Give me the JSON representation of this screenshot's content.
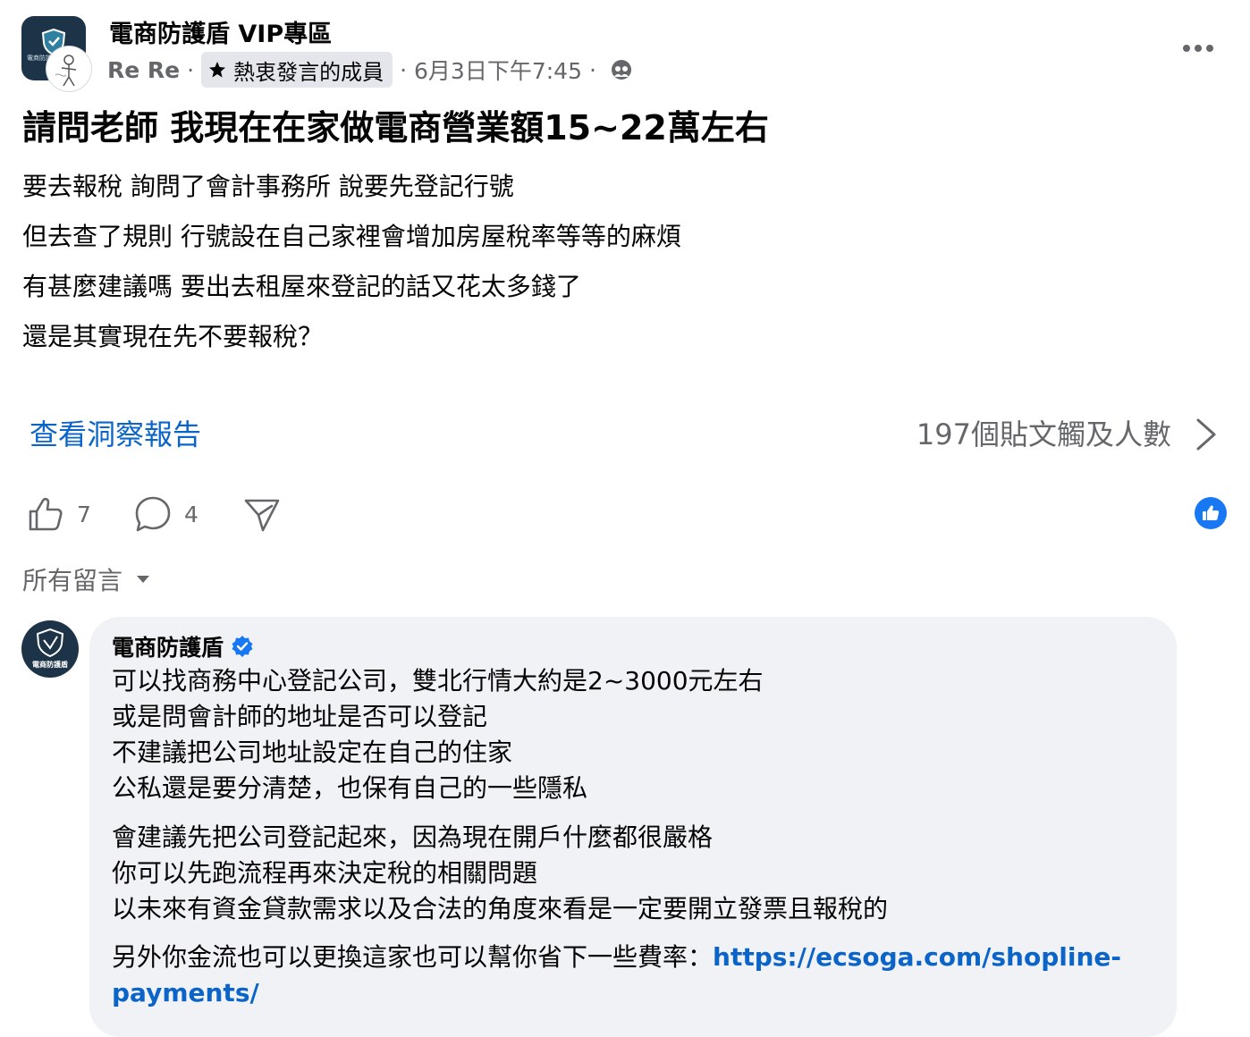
{
  "header": {
    "group_name": "電商防護盾 VIP專區",
    "group_avatar_text": "電商防護",
    "author": "Re Re",
    "badge_label": "熱衷發言的成員",
    "timestamp": "6月3日下午7:45",
    "separator": "·"
  },
  "post": {
    "title": "請問老師 我現在在家做電商營業額15~22萬左右",
    "lines": [
      "要去報稅 詢問了會計事務所 說要先登記行號",
      "但去查了規則 行號設在自己家裡會增加房屋稅率等等的麻煩",
      "有甚麼建議嗎 要出去租屋來登記的話又花太多錢了",
      "還是其實現在先不要報稅？"
    ]
  },
  "insights": {
    "link_label": "查看洞察報告",
    "reach_label": "197個貼文觸及人數"
  },
  "actions": {
    "like_count": "7",
    "comment_count": "4"
  },
  "comments": {
    "sort_label": "所有留言",
    "first": {
      "author": "電商防護盾",
      "avatar_text": "電商防護盾",
      "lines": [
        "可以找商務中心登記公司，雙北行情大約是2~3000元左右",
        "或是問會計師的地址是否可以登記",
        "不建議把公司地址設定在自己的住家",
        "公私還是要分清楚，也保有自己的一些隱私",
        "會建議先把公司登記起來，因為現在開戶什麼都很嚴格",
        "你可以先跑流程再來決定稅的相關問題",
        "以未來有資金貸款需求以及合法的角度來看是一定要開立發票且報稅的"
      ],
      "last_line_prefix": "另外你金流也可以更換這家也可以幫你省下一些費率：",
      "link_part1": "https://ecsoga.com/shopline-",
      "link_part2": "payments/"
    }
  },
  "colors": {
    "link_blue": "#0b65c8",
    "like_blue": "#1877f2",
    "secondary_text": "#65676b",
    "bubble_bg": "#f0f2f5",
    "avatar_navy": "#1d3448"
  },
  "icons": [
    "shield-icon",
    "star-icon",
    "audience-icon",
    "more-icon",
    "chevron-right-icon",
    "like-icon",
    "comment-icon",
    "share-icon",
    "like-bubble-icon",
    "caret-down-icon",
    "verified-icon"
  ]
}
